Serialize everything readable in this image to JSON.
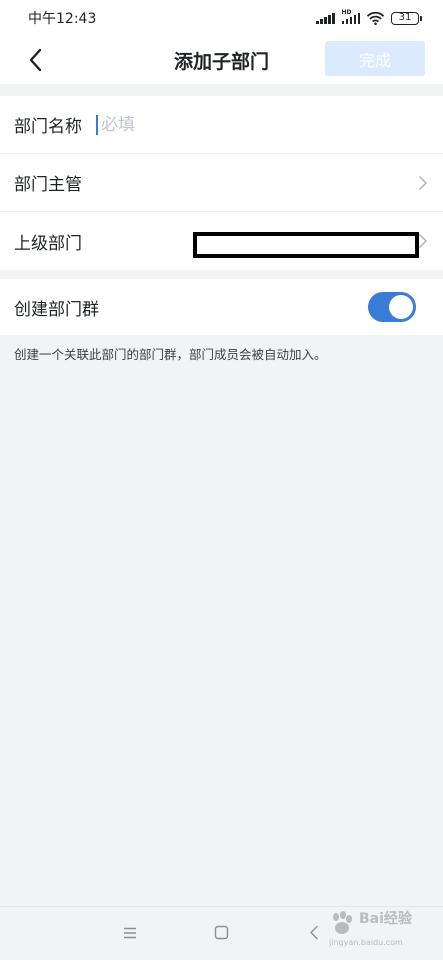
{
  "status_bar": {
    "time": "中午12:43",
    "battery": "31",
    "network_badge": "HD"
  },
  "header": {
    "title": "添加子部门",
    "done_label": "完成"
  },
  "form": {
    "name_label": "部门名称",
    "name_placeholder": "必填",
    "manager_label": "部门主管",
    "parent_label": "上级部门",
    "create_group_label": "创建部门群",
    "create_group_enabled": true,
    "hint": "创建一个关联此部门的部门群，部门成员会被自动加入。"
  },
  "watermark": {
    "text": "Bai经验",
    "url": "jingyan.baidu.com"
  },
  "colors": {
    "accent": "#3a7bd5",
    "done_disabled_bg": "#dbeafc",
    "background": "#f2f3f5"
  }
}
